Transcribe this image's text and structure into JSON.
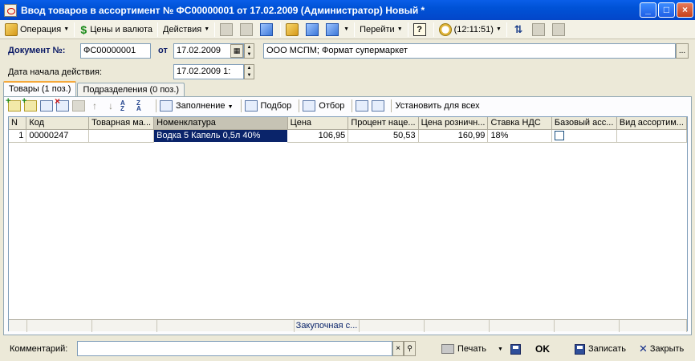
{
  "window": {
    "title": "Ввод товаров в ассортимент № ФС00000001 от 17.02.2009 (Администратор) Новый *",
    "minimize": "_",
    "maximize": "□",
    "close": "×"
  },
  "toolbar": {
    "operation": "Операция",
    "prices": "Цены и валюта",
    "actions": "Действия",
    "goto": "Перейти",
    "help": "?",
    "time": "(12:11:51)"
  },
  "header": {
    "doc_label": "Документ №:",
    "doc_number": "ФС00000001",
    "from_label": "от",
    "doc_date": "17.02.2009",
    "org": "ООО МСПМ; Формат супермаркет",
    "start_label": "Дата начала действия:",
    "start_date": "17.02.2009 1:",
    "select": "..."
  },
  "tabs": [
    {
      "label": "Товары (1 поз.)",
      "active": true
    },
    {
      "label": "Подразделения (0 поз.)",
      "active": false
    }
  ],
  "gridbar": {
    "fill": "Заполнение",
    "pick": "Подбор",
    "filter": "Отбор",
    "set_all": "Установить для всех"
  },
  "table": {
    "columns": [
      "N",
      "Код",
      "Товарная ма...",
      "Номенклатура",
      "Цена",
      "Процент наце...",
      "Цена розничн...",
      "Ставка НДС",
      "Базовый асс...",
      "Вид ассортим..."
    ],
    "rows": [
      [
        "1",
        "00000247",
        "",
        "Водка 5 Капель 0,5л 40%",
        "106,95",
        "50,53",
        "160,99",
        "18%",
        false,
        ""
      ]
    ],
    "footer_cell": "Закупочная с..."
  },
  "bottom": {
    "comment_label": "Комментарий:",
    "comment_value": "",
    "print": "Печать",
    "ok": "OK",
    "save": "Записать",
    "close": "Закрыть"
  }
}
